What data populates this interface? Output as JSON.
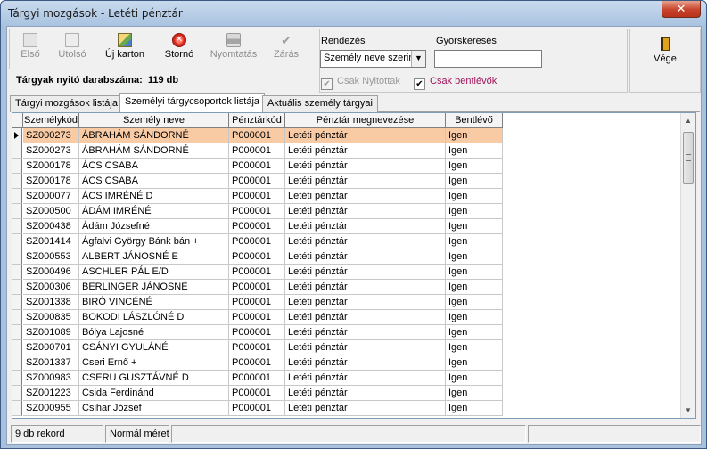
{
  "window": {
    "title": "Tárgyi mozgások - Letéti pénztár",
    "close_glyph": "✕"
  },
  "toolbar": {
    "first_label": "Első",
    "last_label": "Utolsó",
    "new_card_label": "Új karton",
    "storno_label": "Stornó",
    "print_label": "Nyomtatás",
    "close_label": "Zárás"
  },
  "summary": {
    "label": "Tárgyak nyitó darabszáma:",
    "value": "119 db"
  },
  "filters": {
    "sort_label": "Rendezés",
    "sort_value": "Személy neve szerin",
    "quick_search_label": "Gyorskeresés",
    "quick_search_value": "",
    "only_opened_label": "Csak Nyitottak",
    "only_opened_checked": true,
    "only_inside_label": "Csak bentlévők",
    "only_inside_checked": true
  },
  "exit": {
    "label": "Vége"
  },
  "tabs": [
    {
      "label": "Tárgyi mozgások listája",
      "active": false
    },
    {
      "label": "Személyi tárgycsoportok listája",
      "active": true
    },
    {
      "label": "Aktuális személy tárgyai",
      "active": false
    }
  ],
  "grid": {
    "columns": [
      "Személykód",
      "Személy neve",
      "Pénztárkód",
      "Pénztár megnevezése",
      "Bentlévő"
    ],
    "rows": [
      [
        "SZ000273",
        "ÁBRAHÁM SÁNDORNÉ",
        "P000001",
        "Letéti pénztár",
        "Igen"
      ],
      [
        "SZ000273",
        "ÁBRAHÁM SÁNDORNÉ",
        "P000001",
        "Letéti pénztár",
        "Igen"
      ],
      [
        "SZ000178",
        "ÁCS CSABA",
        "P000001",
        "Letéti pénztár",
        "Igen"
      ],
      [
        "SZ000178",
        "ÁCS CSABA",
        "P000001",
        "Letéti pénztár",
        "Igen"
      ],
      [
        "SZ000077",
        "ÁCS IMRÉNÉ  D",
        "P000001",
        "Letéti pénztár",
        "Igen"
      ],
      [
        "SZ000500",
        "ÁDÁM IMRÉNÉ",
        "P000001",
        "Letéti pénztár",
        "Igen"
      ],
      [
        "SZ000438",
        "Ádám Józsefné",
        "P000001",
        "Letéti pénztár",
        "Igen"
      ],
      [
        "SZ001414",
        "Ágfalvi György Bánk bán  +",
        "P000001",
        "Letéti pénztár",
        "Igen"
      ],
      [
        "SZ000553",
        "ALBERT JÁNOSNÉ  E",
        "P000001",
        "Letéti pénztár",
        "Igen"
      ],
      [
        "SZ000496",
        "ASCHLER PÁL  E/D",
        "P000001",
        "Letéti pénztár",
        "Igen"
      ],
      [
        "SZ000306",
        "BERLINGER JÁNOSNÉ",
        "P000001",
        "Letéti pénztár",
        "Igen"
      ],
      [
        "SZ001338",
        "BIRÓ VINCÉNÉ",
        "P000001",
        "Letéti pénztár",
        "Igen"
      ],
      [
        "SZ000835",
        "BOKODI LÁSZLÓNÉ  D",
        "P000001",
        "Letéti pénztár",
        "Igen"
      ],
      [
        "SZ001089",
        "Bólya Lajosné",
        "P000001",
        "Letéti pénztár",
        "Igen"
      ],
      [
        "SZ000701",
        "CSÁNYI  GYULÁNÉ",
        "P000001",
        "Letéti pénztár",
        "Igen"
      ],
      [
        "SZ001337",
        "Cseri Ernő +",
        "P000001",
        "Letéti pénztár",
        "Igen"
      ],
      [
        "SZ000983",
        "CSERU  GUSZTÁVNÉ  D",
        "P000001",
        "Letéti pénztár",
        "Igen"
      ],
      [
        "SZ001223",
        "Csida Ferdinánd",
        "P000001",
        "Letéti pénztár",
        "Igen"
      ],
      [
        "SZ000955",
        "Csihar József",
        "P000001",
        "Letéti pénztár",
        "Igen"
      ]
    ],
    "selected_row": 0
  },
  "status": {
    "records": "9 db rekord",
    "mode": "Normál méret"
  },
  "icons": {
    "first": "first-record-icon",
    "last": "last-record-icon",
    "new_card": "new-card-icon",
    "storno": "storno-icon",
    "print": "printer-icon",
    "close": "close-doc-icon",
    "exit": "door-icon"
  }
}
